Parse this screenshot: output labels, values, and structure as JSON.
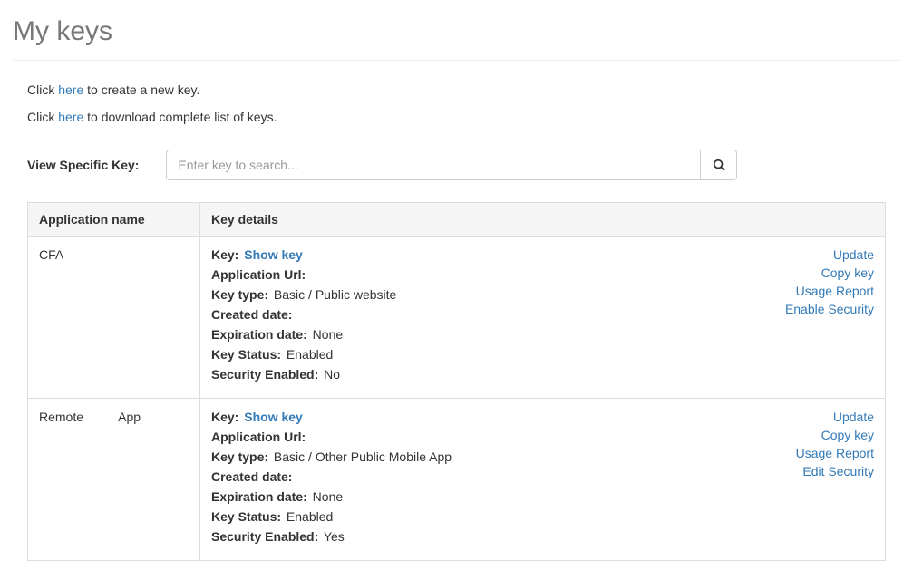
{
  "page_title": "My keys",
  "intro": {
    "create_prefix": "Click ",
    "create_link": "here",
    "create_suffix": " to create a new key.",
    "download_prefix": "Click ",
    "download_link": "here",
    "download_suffix": " to download complete list of keys."
  },
  "search": {
    "label": "View Specific Key:",
    "placeholder": "Enter key to search..."
  },
  "table": {
    "col_app": "Application name",
    "col_details": "Key details"
  },
  "labels": {
    "key": "Key:",
    "show_key": "Show key",
    "app_url": "Application Url:",
    "key_type": "Key type:",
    "created": "Created date:",
    "expiration": "Expiration date:",
    "status": "Key Status:",
    "security": "Security Enabled:"
  },
  "actions": {
    "update": "Update",
    "copy": "Copy key",
    "usage": "Usage Report",
    "enable_sec": "Enable Security",
    "edit_sec": "Edit Security"
  },
  "rows": [
    {
      "app_name": "CFA",
      "app_url": "",
      "key_type": "Basic / Public website",
      "created": "",
      "expiration": "None",
      "status": "Enabled",
      "security": "No",
      "security_action": "enable"
    },
    {
      "app_name": "Remote          App",
      "app_url": "",
      "key_type": "Basic / Other Public Mobile App",
      "created": "",
      "expiration": "None",
      "status": "Enabled",
      "security": "Yes",
      "security_action": "edit"
    }
  ]
}
